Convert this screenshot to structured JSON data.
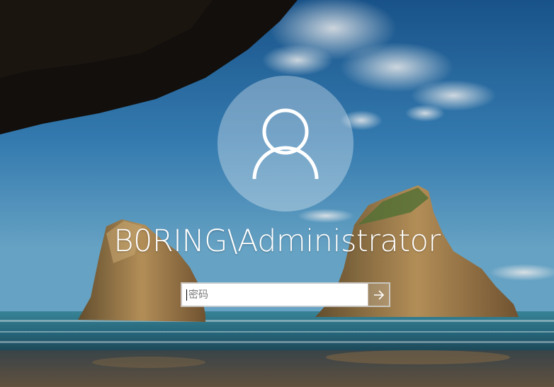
{
  "login": {
    "username": "B0RING\\Administrator",
    "password_placeholder": "密码",
    "password_value": ""
  },
  "icons": {
    "avatar": "user-silhouette-icon",
    "submit": "arrow-right-icon"
  },
  "colors": {
    "sky_top": "#1d5f9c",
    "sea": "#2f8fa8",
    "sand": "#5a4a3a",
    "text": "#ffffff"
  }
}
